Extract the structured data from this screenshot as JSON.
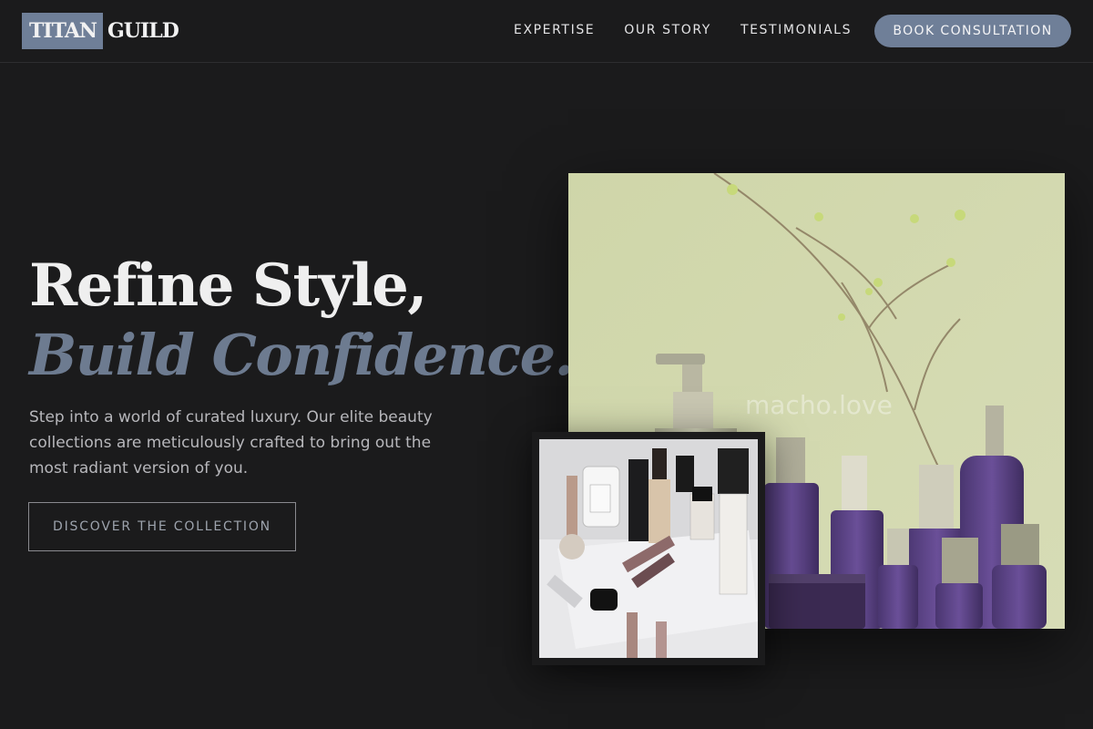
{
  "brand": {
    "logo_box": "TITAN",
    "logo_rest": "GUILD"
  },
  "nav": {
    "links": [
      "EXPERTISE",
      "OUR STORY",
      "TESTIMONIALS"
    ],
    "cta": "BOOK CONSULTATION"
  },
  "hero": {
    "headline_line1": "Refine Style,",
    "headline_line2": "Build Confidence.",
    "description": "Step into a world of curated luxury. Our elite beauty collections are meticulously crafted to bring out the most radiant version of you.",
    "button": "DISCOVER THE COLLECTION"
  },
  "images": {
    "watermark": "macho.love"
  },
  "colors": {
    "background": "#1b1b1c",
    "accent": "#6f7f98",
    "headline_accent": "#6d7b90"
  }
}
